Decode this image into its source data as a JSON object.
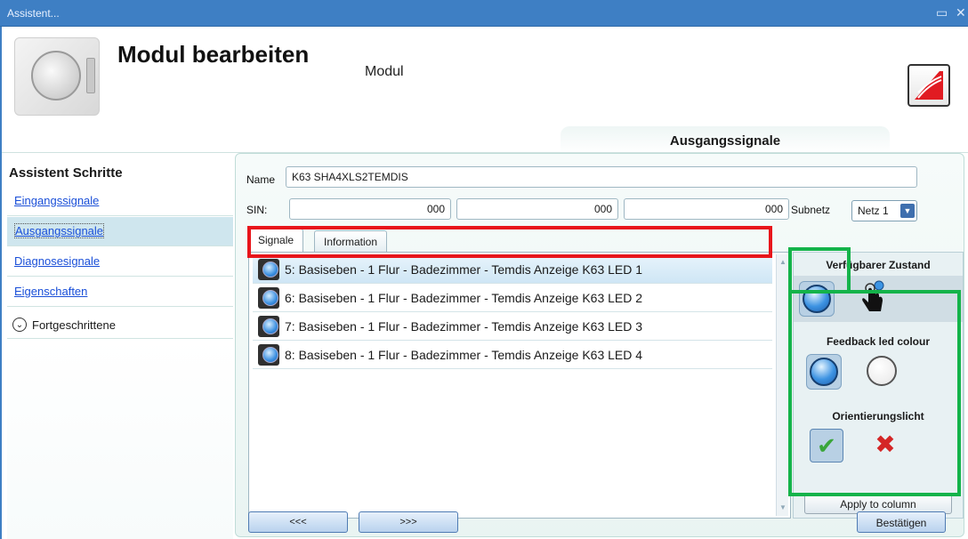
{
  "window": {
    "title": "Assistent...",
    "buttons": [
      "▭",
      "✕"
    ]
  },
  "header": {
    "title": "Modul bearbeiten",
    "subtitle": "Modul",
    "section_tab": "Ausgangssignale"
  },
  "wizard": {
    "title": "Assistent Schritte",
    "steps": [
      {
        "label": "Eingangssignale",
        "selected": false
      },
      {
        "label": "Ausgangssignale",
        "selected": true
      },
      {
        "label": "Diagnosesignale",
        "selected": false
      },
      {
        "label": "Eigenschaften",
        "selected": false
      }
    ],
    "advanced": "Fortgeschrittene",
    "advanced_icon": "chevron-down-circle-icon"
  },
  "form": {
    "name_label": "Name",
    "name_value": "K63 SHA4XLS2TEMDIS",
    "sin_label": "SIN:",
    "sin_values": [
      "000",
      "000",
      "000"
    ],
    "subnet_label": "Subnetz",
    "subnet_value": "Netz 1"
  },
  "tabs": [
    {
      "label": "Signale",
      "active": true
    },
    {
      "label": "Information",
      "active": false
    }
  ],
  "signals": [
    {
      "label": "5: Basiseben - 1 Flur - Badezimmer - Temdis Anzeige K63 LED 1",
      "selected": true
    },
    {
      "label": "6: Basiseben - 1 Flur - Badezimmer - Temdis Anzeige K63 LED 2",
      "selected": false
    },
    {
      "label": "7: Basiseben - 1 Flur - Badezimmer - Temdis Anzeige K63 LED 3",
      "selected": false
    },
    {
      "label": "8: Basiseben - 1 Flur - Badezimmer - Temdis Anzeige K63 LED 4",
      "selected": false
    }
  ],
  "side": {
    "available_state_title": "Verfügbarer Zustand",
    "feedback_title": "Feedback led colour",
    "orientation_title": "Orientierungslicht",
    "apply_label": "Apply to column"
  },
  "footer": {
    "back_label": "<<<",
    "next_label": ">>>",
    "confirm_label": "Bestätigen"
  },
  "colors": {
    "titlebar": "#3e7fc4",
    "highlight_red": "#e8151b",
    "highlight_green": "#14b34a"
  }
}
